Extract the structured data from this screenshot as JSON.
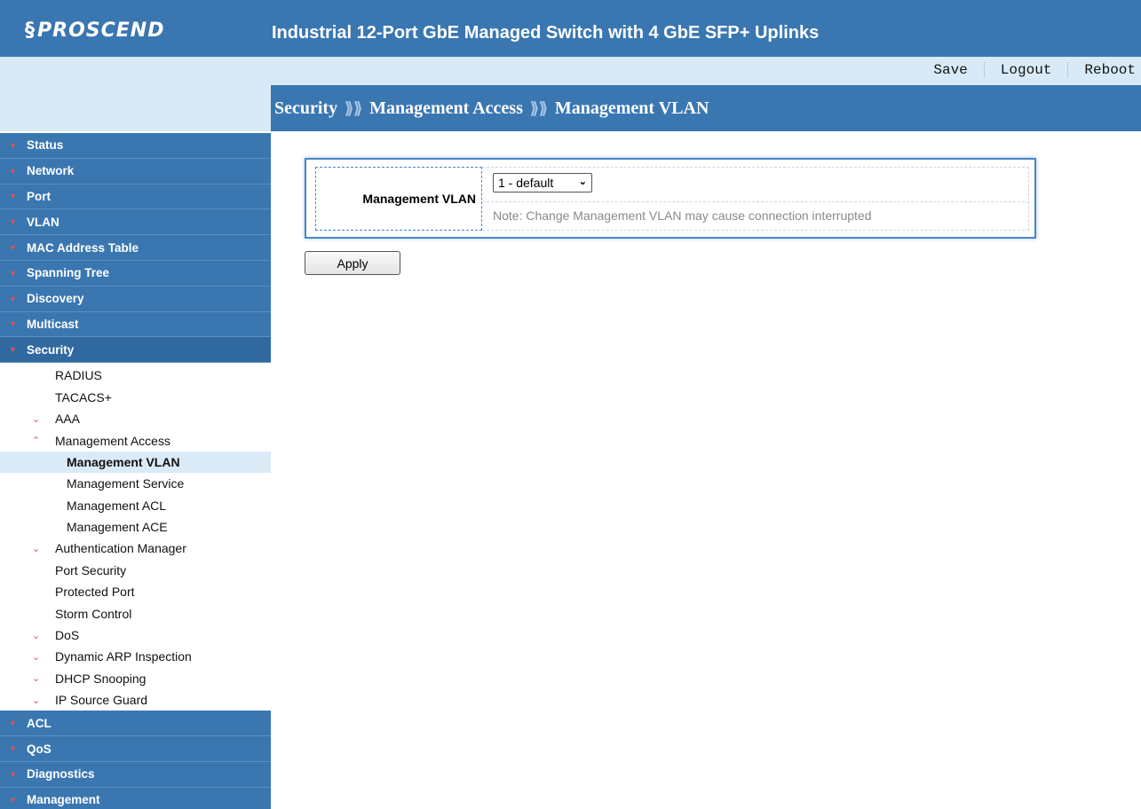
{
  "header": {
    "logo_text": "PROSCEND",
    "logo_mark": "§",
    "product_title": "Industrial 12-Port GbE Managed Switch with 4 GbE SFP+ Uplinks"
  },
  "toplinks": {
    "save": "Save",
    "logout": "Logout",
    "reboot": "Reboot"
  },
  "breadcrumb": {
    "items": [
      "Security",
      "Management Access",
      "Management VLAN"
    ],
    "separator": "⟫⟫"
  },
  "sidebar": {
    "menu_top": [
      "Status",
      "Network",
      "Port",
      "VLAN",
      "MAC Address Table",
      "Spanning Tree",
      "Discovery",
      "Multicast"
    ],
    "active": "Security",
    "submenu": {
      "radius": "RADIUS",
      "tacacs": "TACACS+",
      "aaa": "AAA",
      "management_access": "Management Access",
      "management_vlan": "Management VLAN",
      "management_service": "Management Service",
      "management_acl": "Management ACL",
      "management_ace": "Management ACE",
      "authentication_manager": "Authentication Manager",
      "port_security": "Port Security",
      "protected_port": "Protected Port",
      "storm_control": "Storm Control",
      "dos": "DoS",
      "dynamic_arp": "Dynamic ARP Inspection",
      "dhcp_snooping": "DHCP Snooping",
      "ip_source_guard": "IP Source Guard"
    },
    "menu_bottom": [
      "ACL",
      "QoS",
      "Diagnostics",
      "Management"
    ]
  },
  "content": {
    "field_label": "Management VLAN",
    "select_value": "1 - default",
    "note": "Note: Change Management VLAN may cause connection interrupted",
    "apply": "Apply"
  },
  "colors": {
    "header_blue": "#3a77b1",
    "light_blue": "#d8eaf7",
    "chevron_red": "#d9534f"
  }
}
